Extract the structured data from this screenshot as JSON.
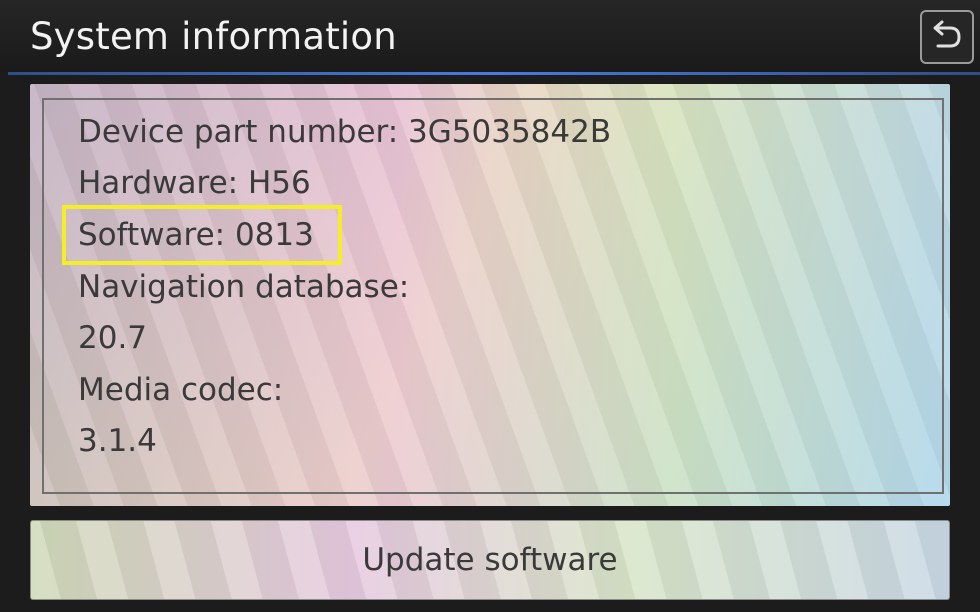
{
  "header": {
    "title": "System information",
    "back_icon": "back-arrow-icon"
  },
  "info": {
    "device_part_number": "Device part number: 3G5035842B",
    "hardware": "Hardware: H56",
    "software": "Software: 0813",
    "navigation_database_label": "Navigation database:",
    "navigation_database_value": "20.7",
    "media_codec_label": "Media codec:",
    "media_codec_value": "3.1.4"
  },
  "actions": {
    "update_label": "Update software"
  },
  "colors": {
    "highlight": "#f4ee2a",
    "header_accent": "#4a7ae0"
  }
}
